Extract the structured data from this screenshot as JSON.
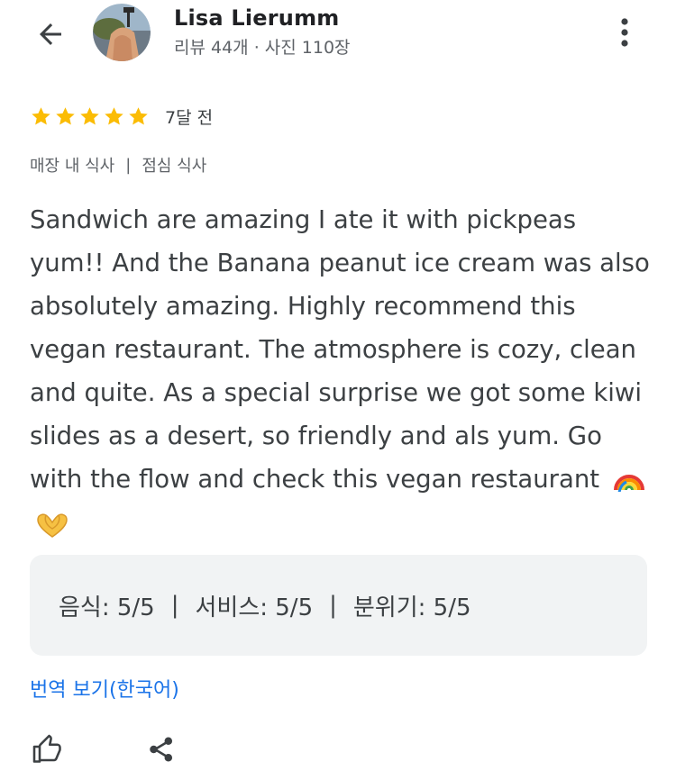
{
  "header": {
    "back_icon": "arrow-left-icon",
    "avatar_icon": "profile-photo",
    "user_name": "Lisa Lierumm",
    "user_meta": "리뷰 44개 · 사진 110장",
    "more_icon": "more-vertical-icon"
  },
  "review": {
    "rating": 5,
    "max_rating": 5,
    "star_color": "#fbbc04",
    "date": "7달 전",
    "tags": [
      "매장 내 식사",
      "점심 식사"
    ],
    "tag_separator": "|",
    "text": "Sandwich are amazing I ate it with pickpeas yum!! And the Banana peanut ice cream was also absolutely amazing. Highly recommend this vegan restaurant. The atmosphere is cozy, clean and quite. As a special surprise we got some kiwi slides as a desert, so friendly and als yum. Go with the flow and check this vegan restaurant",
    "emojis": [
      "rainbow-icon",
      "heart-hands-icon"
    ]
  },
  "scores": {
    "separator": "|",
    "items": [
      {
        "label": "음식: 5/5"
      },
      {
        "label": "서비스: 5/5"
      },
      {
        "label": "분위기: 5/5"
      }
    ]
  },
  "translate_link": "번역 보기(한국어)",
  "colors": {
    "link": "#1a73e8",
    "score_background": "#f1f3f4"
  },
  "actions": {
    "like_icon": "thumbs-up-icon",
    "share_icon": "share-icon"
  }
}
